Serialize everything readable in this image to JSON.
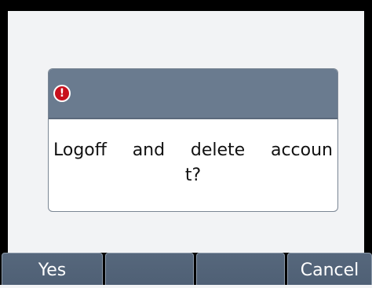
{
  "dialog": {
    "icon": "alert-icon",
    "icon_glyph": "!",
    "message_line1_words": [
      "Logoff",
      "and",
      "delete",
      "accoun"
    ],
    "message_line2": "t?"
  },
  "softkeys": {
    "key1": "Yes",
    "key2": "",
    "key3": "",
    "key4": "Cancel"
  },
  "colors": {
    "header": "#6a7b8f",
    "alert": "#c8101d",
    "softkey": "#56677c",
    "background": "#f2f3f5"
  }
}
